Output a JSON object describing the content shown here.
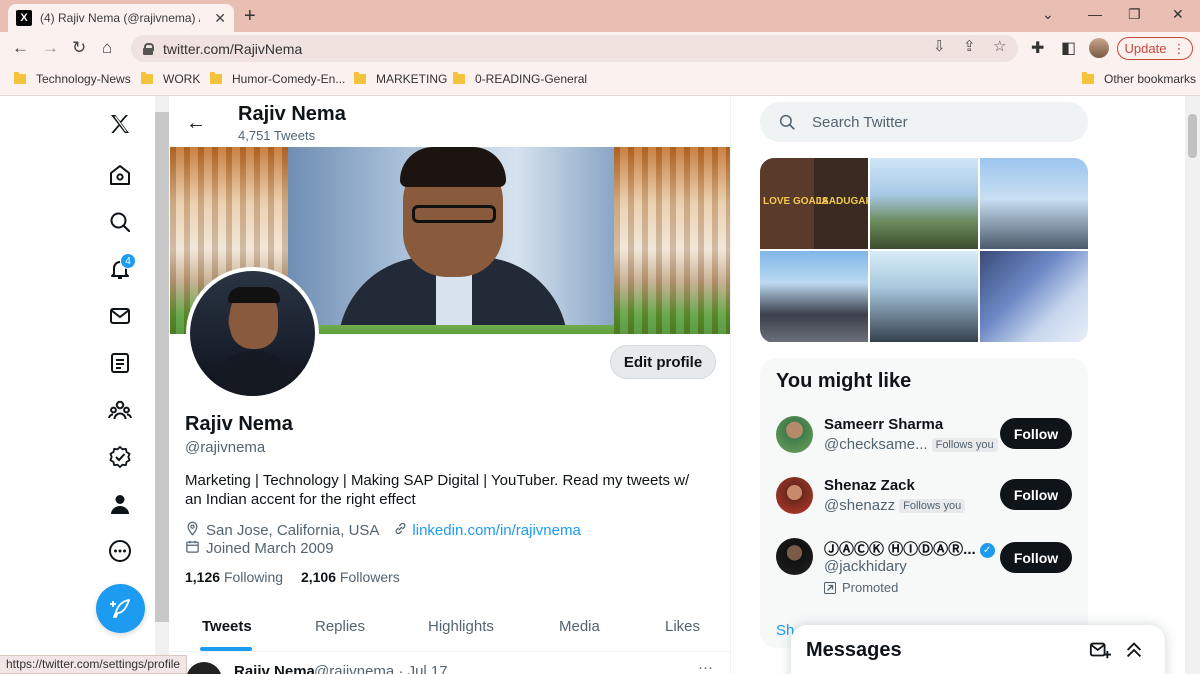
{
  "browser": {
    "tab_title": "(4) Rajiv Nema (@rajivnema) / Tw",
    "url": "twitter.com/RajivNema",
    "update_label": "Update",
    "status_url": "https://twitter.com/settings/profile",
    "bookmarks": [
      "Technology-News",
      "WORK",
      "Humor-Comedy-En...",
      "MARKETING",
      "0-READING-General"
    ],
    "other_bookmarks": "Other bookmarks"
  },
  "nav": {
    "notification_count": "4",
    "icons": [
      "x-logo-icon",
      "home-icon",
      "search-icon",
      "notifications-icon",
      "messages-icon",
      "lists-icon",
      "communities-icon",
      "verified-icon",
      "profile-icon",
      "more-icon"
    ]
  },
  "header": {
    "name": "Rajiv Nema",
    "tweet_count": "4,751 Tweets"
  },
  "profile": {
    "name": "Rajiv Nema",
    "handle": "@rajivnema",
    "bio": "Marketing | Technology | Making SAP Digital | YouTuber. Read my tweets w/ an Indian accent for the right effect",
    "location": "San Jose, California, USA",
    "website": "linkedin.com/in/rajivnema",
    "joined": "Joined March 2009",
    "following_count": "1,126",
    "following_label": "Following",
    "followers_count": "2,106",
    "followers_label": "Followers",
    "edit_label": "Edit profile"
  },
  "tabs": [
    "Tweets",
    "Replies",
    "Highlights",
    "Media",
    "Likes"
  ],
  "tweet_preview": {
    "name": "Rajiv Nema",
    "meta": "@rajivnema · Jul 17",
    "more": "···"
  },
  "search": {
    "placeholder": "Search Twitter"
  },
  "media_text": {
    "love_goals": "LOVE GOALS",
    "jaadugar": "JAADUGAR"
  },
  "who_to_follow": {
    "title": "You might like",
    "follow_label": "Follow",
    "users": [
      {
        "name": "Sameerr Sharma",
        "handle": "@checksame...",
        "badge": "Follows you"
      },
      {
        "name": "Shenaz Zack",
        "handle": "@shenazz",
        "badge": "Follows you"
      },
      {
        "name": "ⒿⒶⒸⓀ ⒽⒾⒹⒶⓇ...",
        "handle": "@jackhidary",
        "promoted": "Promoted"
      }
    ],
    "show_more": "Sh"
  },
  "messages": {
    "title": "Messages"
  }
}
